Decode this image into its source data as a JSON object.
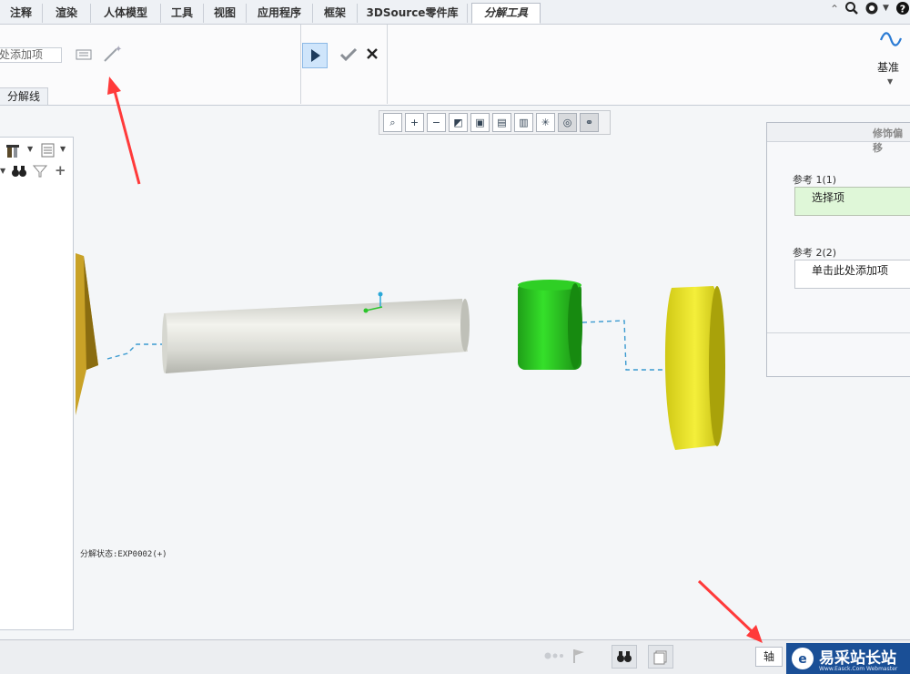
{
  "tabs": [
    {
      "label": "注释"
    },
    {
      "label": "渲染"
    },
    {
      "label": "人体模型"
    },
    {
      "label": "工具"
    },
    {
      "label": "视图"
    },
    {
      "label": "应用程序"
    },
    {
      "label": "框架"
    },
    {
      "label": "3DSource零件库"
    },
    {
      "label": "分解工具"
    }
  ],
  "ribbon": {
    "ref_field_text": "处添加项",
    "group_label": "分解线",
    "datum_label": "基准"
  },
  "tree_panel": {
    "icons": [
      "tools-icon",
      "dropdown-arrow-icon",
      "list-icon",
      "dropdown-arrow-icon",
      "binoculars-icon",
      "filter-icon",
      "plus-icon"
    ]
  },
  "canvas": {
    "explode_state": "分解状态:EXP0002(+)"
  },
  "dialog": {
    "title": "修饰偏移",
    "ref1_label": "参考 1(1)",
    "ref1_value": "选择项",
    "ref2_label": "参考 2(2)",
    "ref2_value": "单击此处添加项"
  },
  "statusbar": {
    "axis_label": "轴",
    "watermark_text": "易采站长站",
    "watermark_sub": "Www.Easck.Com Webmaster"
  },
  "colors": {
    "accent_red": "#ff3a3a",
    "dialog_selected_bg": "#dff7d8",
    "part_gold": "#c9a227",
    "part_green": "#27c41f",
    "part_yellow": "#e6e12a",
    "part_shaft": "#dedfd8"
  }
}
